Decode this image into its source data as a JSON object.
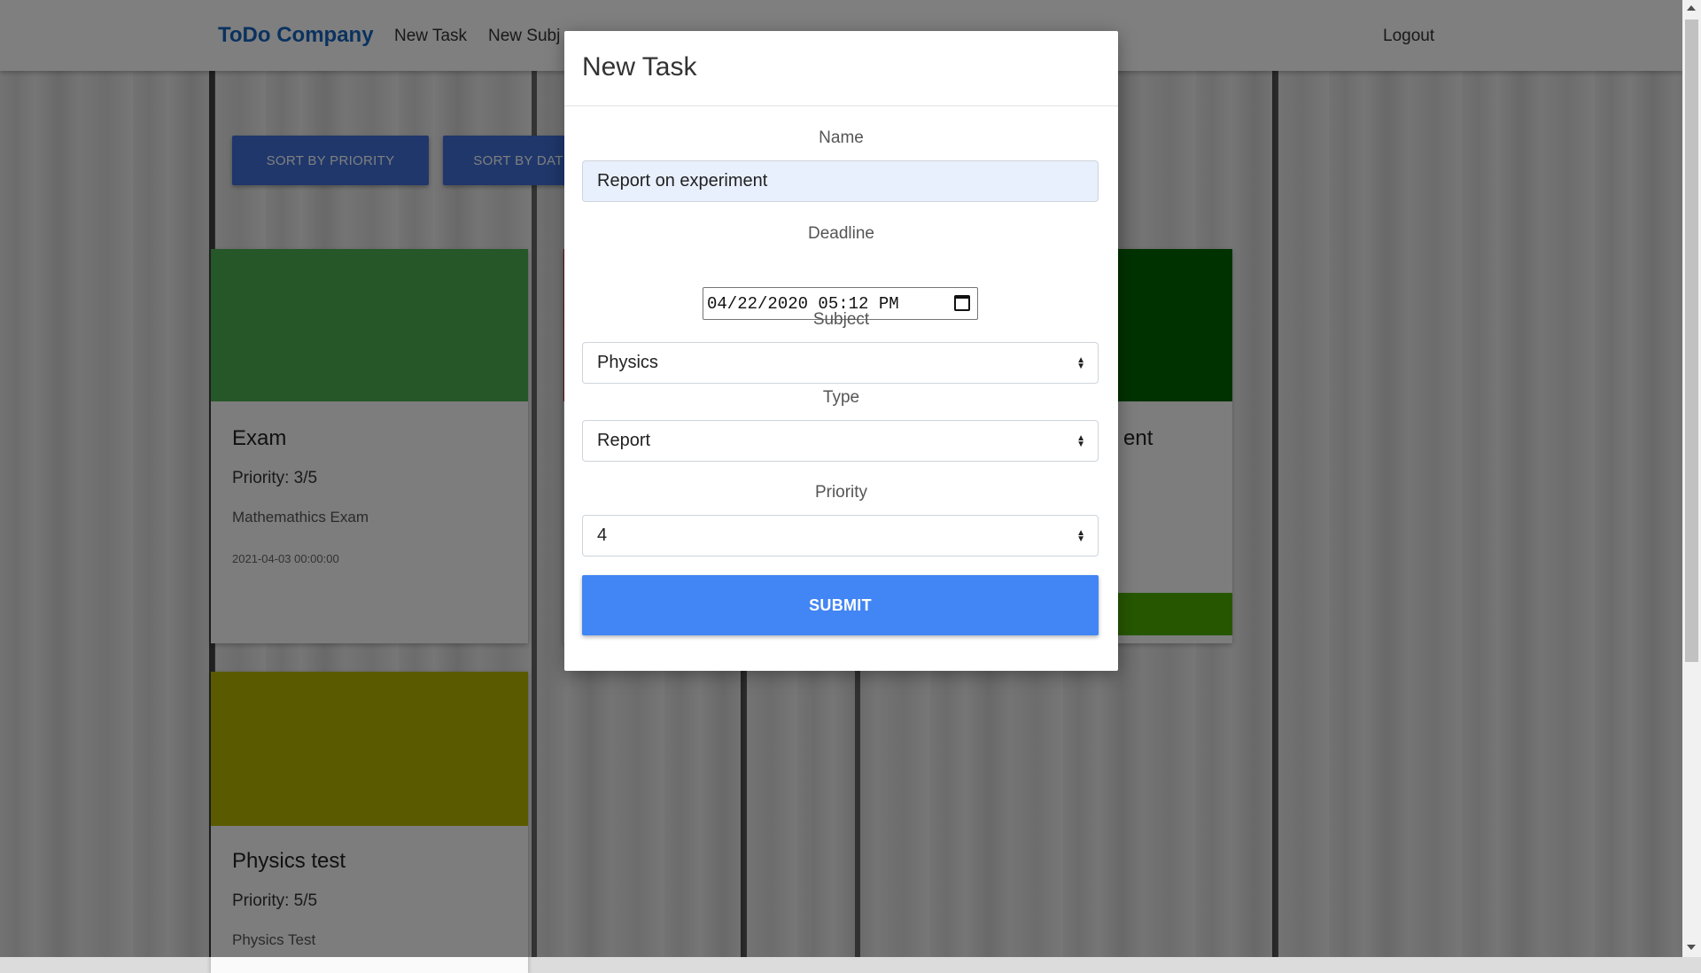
{
  "navbar": {
    "brand": "ToDo Company",
    "links": [
      "New Task",
      "New Subj"
    ],
    "logout": "Logout"
  },
  "sort_buttons": [
    "SORT BY PRIORITY",
    "SORT BY DAT"
  ],
  "cards": [
    {
      "title": "Exam",
      "priority": "Priority: 3/5",
      "description": "Mathemathics Exam",
      "date": "2021-04-03 00:00:00",
      "color": "#4caf50"
    },
    {
      "title": "ent",
      "color": "#006400",
      "footer_color": "#4caf00"
    },
    {
      "title": "Physics test",
      "priority": "Priority: 5/5",
      "description": "Physics Test",
      "color": "#b5b500"
    }
  ],
  "modal": {
    "title": "New Task",
    "name_label": "Name",
    "name_value": "Report on experiment",
    "deadline_label": "Deadline",
    "deadline_value": "04/22/2020 05:12 PM",
    "subject_label": "Subject",
    "subject_value": "Physics",
    "type_label": "Type",
    "type_value": "Report",
    "priority_label": "Priority",
    "priority_value": "4",
    "submit_label": "SUBMIT"
  },
  "colors": {
    "brand": "#1565c0",
    "primary_button": "#4285f4",
    "sort_button": "#3f6fd6"
  }
}
